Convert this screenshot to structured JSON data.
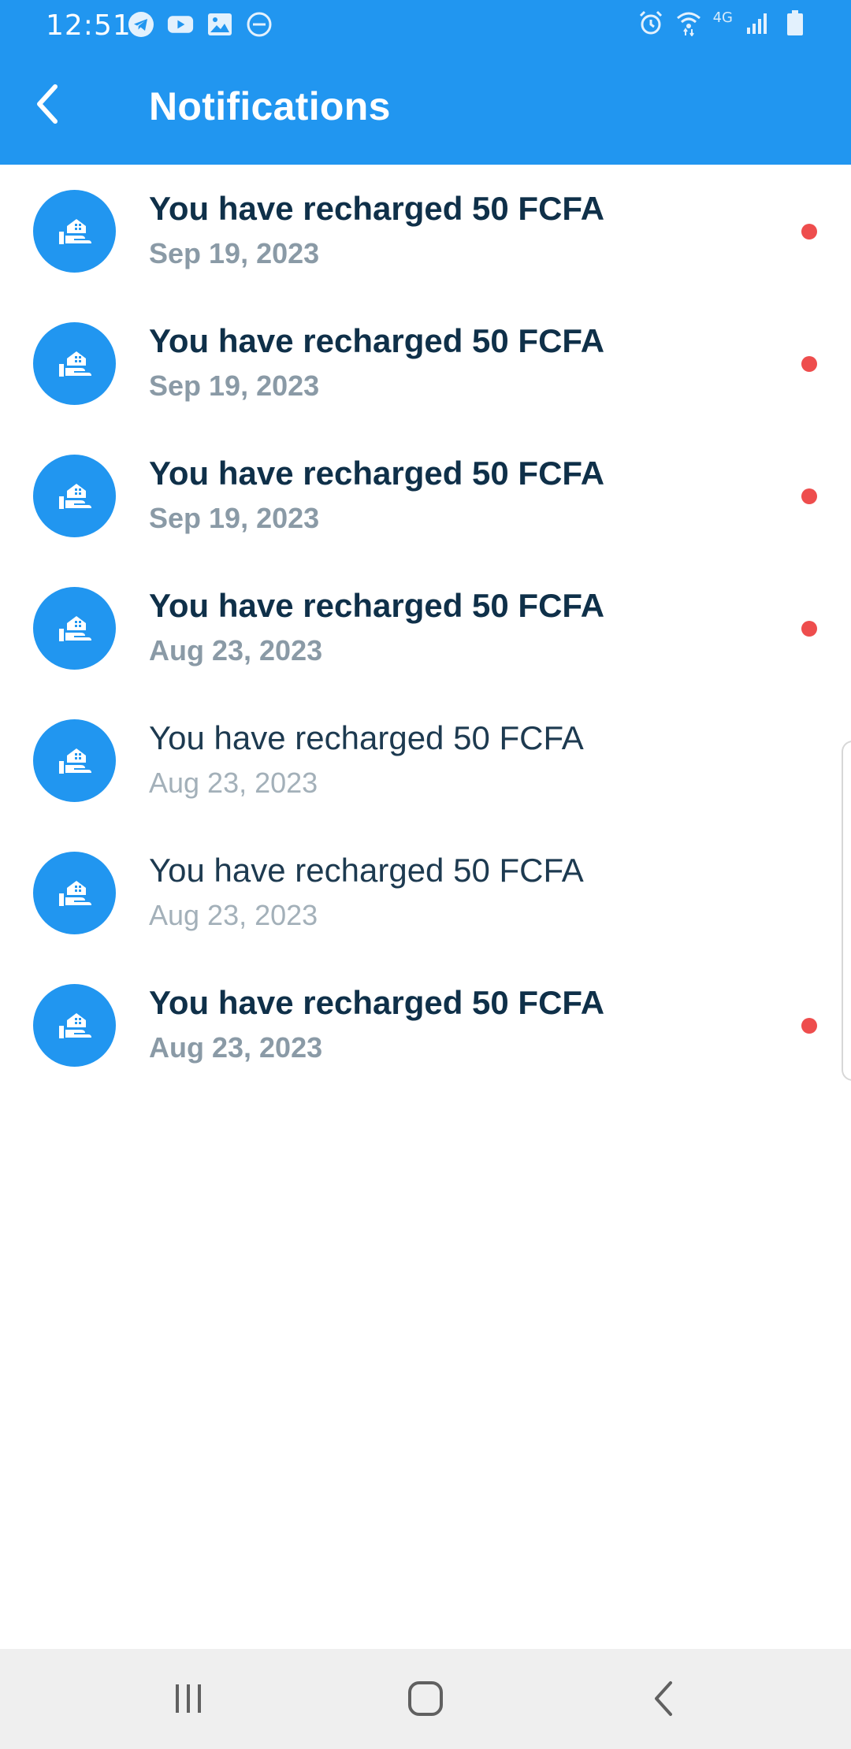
{
  "status_bar": {
    "time": "12:51",
    "network": "4G",
    "left_icons": [
      "telegram-icon",
      "youtube-icon",
      "gallery-icon",
      "do-not-disturb-icon"
    ],
    "right_icons": [
      "alarm-icon",
      "wifi-icon",
      "signal-icon",
      "battery-icon"
    ]
  },
  "header": {
    "title": "Notifications",
    "back_icon": "chevron-left-icon"
  },
  "colors": {
    "primary": "#2196f0",
    "unread_dot": "#ee4d4d",
    "title_text": "#0f3049",
    "date_text": "#8a9aa6"
  },
  "notifications": [
    {
      "title": "You have recharged 50 FCFA",
      "date": "Sep 19, 2023",
      "unread": true
    },
    {
      "title": "You have recharged 50 FCFA",
      "date": "Sep 19, 2023",
      "unread": true
    },
    {
      "title": "You have recharged 50 FCFA",
      "date": "Sep 19, 2023",
      "unread": true
    },
    {
      "title": "You have recharged 50 FCFA",
      "date": "Aug 23, 2023",
      "unread": true
    },
    {
      "title": "You have recharged 50 FCFA",
      "date": "Aug 23, 2023",
      "unread": false
    },
    {
      "title": "You have recharged 50 FCFA",
      "date": "Aug 23, 2023",
      "unread": false
    },
    {
      "title": "You have recharged 50 FCFA",
      "date": "Aug 23, 2023",
      "unread": true
    }
  ],
  "nav_bar": {
    "buttons": [
      "recent-apps-icon",
      "home-icon",
      "back-icon"
    ]
  }
}
